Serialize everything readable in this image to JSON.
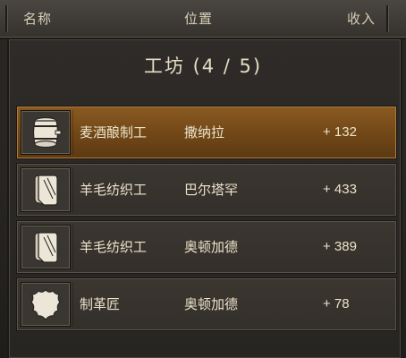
{
  "header": {
    "col_name": "名称",
    "col_location": "位置",
    "col_income": "收入"
  },
  "section": {
    "title": "工坊 (4 / 5)"
  },
  "workshops": [
    {
      "name": "麦酒酿制工",
      "location": "撒纳拉",
      "income": "+ 132",
      "icon": "barrel-icon",
      "selected": true
    },
    {
      "name": "羊毛纺织工",
      "location": "巴尔塔罕",
      "income": "+ 433",
      "icon": "cloth-roll-icon",
      "selected": false
    },
    {
      "name": "羊毛纺织工",
      "location": "奥顿加德",
      "income": "+ 389",
      "icon": "cloth-roll-icon",
      "selected": false
    },
    {
      "name": "制革匠",
      "location": "奥顿加德",
      "income": "+ 78",
      "icon": "leather-hide-icon",
      "selected": false
    }
  ],
  "colors": {
    "selected_row": "#7a4e1c",
    "row": "#38332e",
    "text": "#ece3cc"
  }
}
